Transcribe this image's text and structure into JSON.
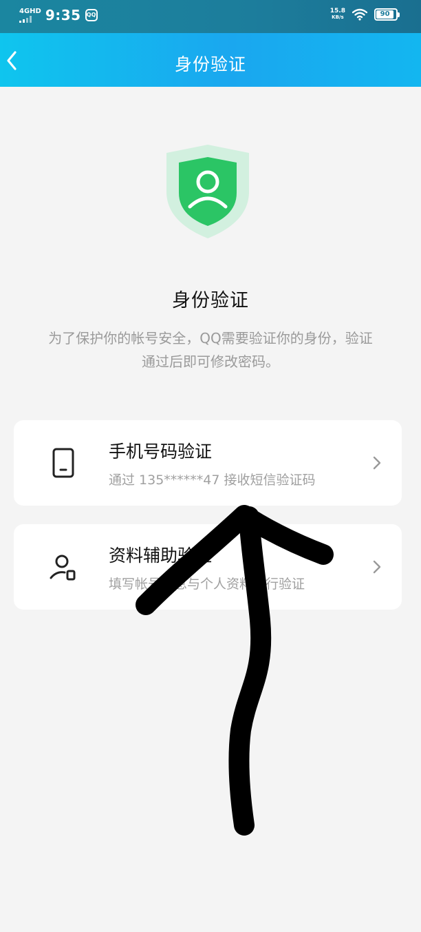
{
  "status_bar": {
    "network": "4GHD",
    "time": "9:35",
    "qq_badge": "QQ",
    "speed_value": "15.8",
    "speed_unit": "KB/s",
    "battery": "90"
  },
  "nav": {
    "title": "身份验证"
  },
  "header": {
    "title": "身份验证",
    "description": "为了保护你的帐号安全，QQ需要验证你的身份，验证通过后即可修改密码。"
  },
  "options": [
    {
      "title": "手机号码验证",
      "subtitle": "通过 135******47 接收短信验证码",
      "icon": "phone-icon"
    },
    {
      "title": "资料辅助验证",
      "subtitle": "填写帐号信息与个人资料进行验证",
      "icon": "user-profile-icon"
    }
  ],
  "colors": {
    "header_gradient_start": "#0fc5ee",
    "header_gradient_end": "#1aa7ef",
    "shield_green": "#2bc565",
    "shield_light": "#cfeedd",
    "scribble": "#000000"
  }
}
